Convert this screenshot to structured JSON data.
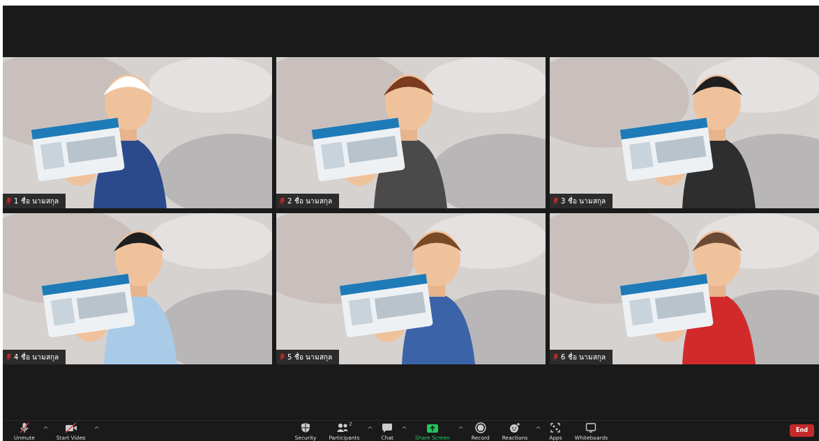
{
  "tiles": [
    {
      "name": "1 ชื่อ นามสกุล",
      "muted": true,
      "kind": "picture"
    },
    {
      "name": "2 ชื่อ นามสกุล",
      "muted": true,
      "kind": "picture"
    },
    {
      "name": "3 ชื่อ นามสกุล",
      "muted": true,
      "kind": "picture"
    },
    {
      "name": "4 ชื่อ นามสกุล",
      "muted": true,
      "kind": "picture"
    },
    {
      "name": "5 ชื่อ นามสกุล",
      "muted": true,
      "kind": "picture"
    },
    {
      "name": "6 ชื่อ นามสกุล",
      "muted": true,
      "kind": "picture"
    }
  ],
  "toolbar_left": [
    {
      "label": "Unmute",
      "kind": "mic",
      "menu": true,
      "off": true
    },
    {
      "label": "Start Video",
      "kind": "video",
      "menu": true,
      "off": true
    }
  ],
  "toolbar_center": [
    {
      "label": "Security",
      "kind": "shield",
      "menu": false,
      "highlight": false
    },
    {
      "label": "Participants",
      "kind": "people",
      "count": "2",
      "menu": true,
      "highlight": false
    },
    {
      "label": "Chat",
      "kind": "chat",
      "menu": true,
      "highlight": false
    },
    {
      "label": "Share Screen",
      "kind": "share",
      "menu": true,
      "highlight": true
    },
    {
      "label": "Record",
      "kind": "record",
      "menu": false,
      "highlight": false
    },
    {
      "label": "Reactions",
      "kind": "smile",
      "menu": true,
      "highlight": false
    },
    {
      "label": "Apps",
      "kind": "apps",
      "menu": false,
      "highlight": false
    },
    {
      "label": "Whiteboards",
      "kind": "board",
      "menu": false,
      "highlight": false
    }
  ],
  "end_button": "End"
}
